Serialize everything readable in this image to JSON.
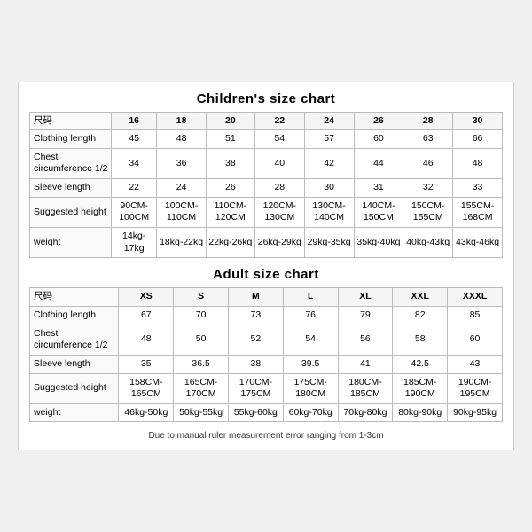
{
  "children_chart": {
    "title": "Children's size chart",
    "columns": [
      "尺码",
      "16",
      "18",
      "20",
      "22",
      "24",
      "26",
      "28",
      "30"
    ],
    "rows": [
      {
        "label": "Clothing length",
        "values": [
          "45",
          "48",
          "51",
          "54",
          "57",
          "60",
          "63",
          "66"
        ]
      },
      {
        "label": "Chest circumference 1/2",
        "values": [
          "34",
          "36",
          "38",
          "40",
          "42",
          "44",
          "46",
          "48"
        ]
      },
      {
        "label": "Sleeve length",
        "values": [
          "22",
          "24",
          "26",
          "28",
          "30",
          "31",
          "32",
          "33"
        ]
      },
      {
        "label": "Suggested height",
        "values": [
          "90CM-100CM",
          "100CM-110CM",
          "110CM-120CM",
          "120CM-130CM",
          "130CM-140CM",
          "140CM-150CM",
          "150CM-155CM",
          "155CM-168CM"
        ]
      },
      {
        "label": "weight",
        "values": [
          "14kg-17kg",
          "18kg-22kg",
          "22kg-26kg",
          "26kg-29kg",
          "29kg-35kg",
          "35kg-40kg",
          "40kg-43kg",
          "43kg-46kg"
        ]
      }
    ]
  },
  "adult_chart": {
    "title": "Adult size chart",
    "columns": [
      "尺码",
      "XS",
      "S",
      "M",
      "L",
      "XL",
      "XXL",
      "XXXL"
    ],
    "rows": [
      {
        "label": "Clothing length",
        "values": [
          "67",
          "70",
          "73",
          "76",
          "79",
          "82",
          "85"
        ]
      },
      {
        "label": "Chest circumference 1/2",
        "values": [
          "48",
          "50",
          "52",
          "54",
          "56",
          "58",
          "60"
        ]
      },
      {
        "label": "Sleeve length",
        "values": [
          "35",
          "36.5",
          "38",
          "39.5",
          "41",
          "42.5",
          "43"
        ]
      },
      {
        "label": "Suggested height",
        "values": [
          "158CM-165CM",
          "165CM-170CM",
          "170CM-175CM",
          "175CM-180CM",
          "180CM-185CM",
          "185CM-190CM",
          "190CM-195CM"
        ]
      },
      {
        "label": "weight",
        "values": [
          "46kg-50kg",
          "50kg-55kg",
          "55kg-60kg",
          "60kg-70kg",
          "70kg-80kg",
          "80kg-90kg",
          "90kg-95kg"
        ]
      }
    ]
  },
  "note": "Due to manual ruler measurement error ranging from 1-3cm"
}
